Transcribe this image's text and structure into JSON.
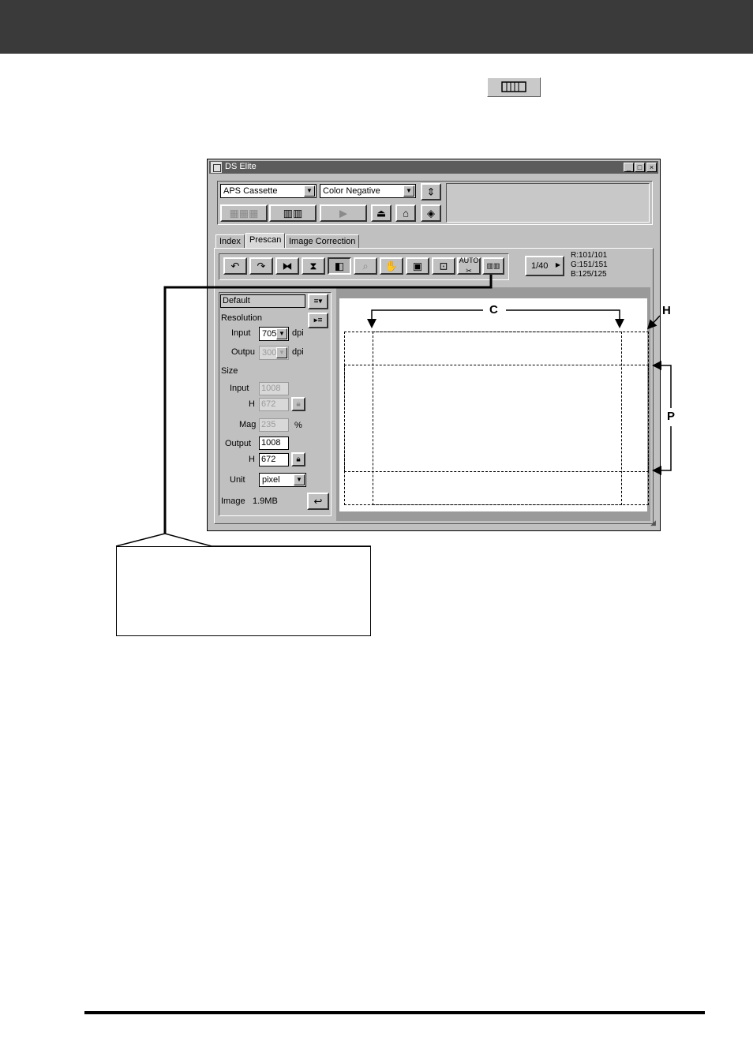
{
  "window": {
    "title": "DS Elite",
    "controls": {
      "minimize": "_",
      "maximize": "□",
      "close": "×"
    }
  },
  "top_controls": {
    "film_type": "APS Cassette",
    "film_mode": "Color Negative"
  },
  "tabs": [
    {
      "label": "Index"
    },
    {
      "label": "Prescan"
    },
    {
      "label": "Image Correction"
    }
  ],
  "frame_counter": "1/40",
  "rgb": {
    "r": "R:101/101",
    "g": "G:151/151",
    "b": "B:125/125"
  },
  "settings": {
    "preset": "Default",
    "resolution_label": "Resolution",
    "input_label": "Input",
    "input_dpi": "705",
    "output_label": "Outpu",
    "output_dpi": "300",
    "dpi_unit": "dpi",
    "size_label": "Size",
    "size_input_label": "Input",
    "size_input_w": "1008",
    "size_input_h_label": "H",
    "size_input_h": "672",
    "mag_label": "Mag",
    "mag_value": "235",
    "mag_unit": "%",
    "size_output_label": "Output",
    "size_output_w": "1008",
    "size_output_h_label": "H",
    "size_output_h": "672",
    "unit_label": "Unit",
    "unit_value": "pixel",
    "image_label": "Image",
    "image_size": "1.9MB"
  },
  "annotations": {
    "c": "C",
    "h": "H",
    "p": "P"
  },
  "colors": {
    "topbar": "#3a3a3a",
    "window": "#c0c0c0",
    "titlebar": "#5c5c5c"
  }
}
